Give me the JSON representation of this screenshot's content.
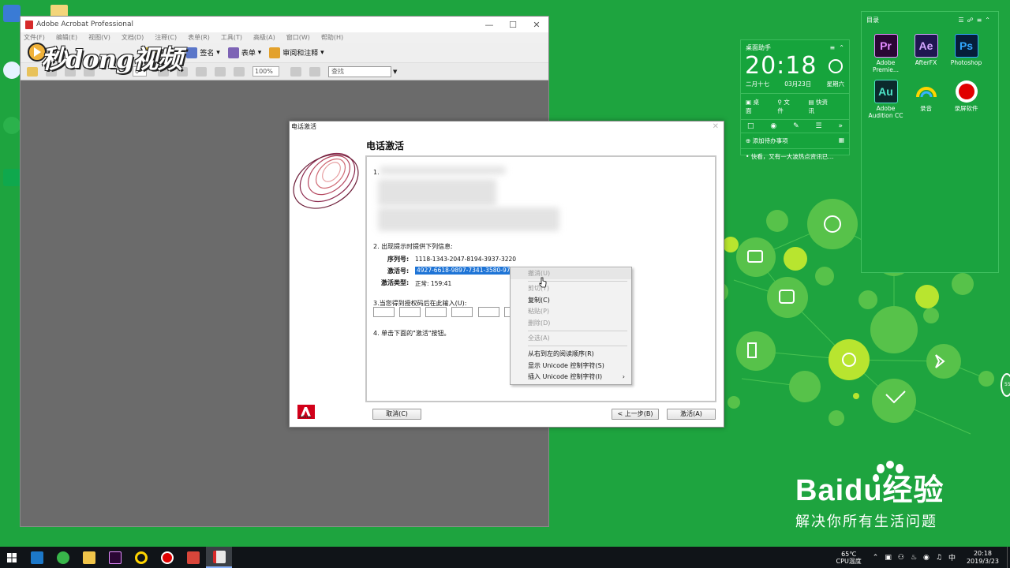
{
  "acrobat": {
    "title": "Adobe Acrobat Professional",
    "menu": [
      "文件(F)",
      "编辑(E)",
      "视图(V)",
      "文档(D)",
      "注释(C)",
      "表单(R)",
      "工具(T)",
      "高级(A)",
      "窗口(W)",
      "帮助(H)"
    ],
    "toolbar": {
      "security": "安全",
      "sign": "签名",
      "forms": "表单",
      "review": "审阅和注释"
    },
    "page_number": "0",
    "zoom": "100%",
    "find_placeholder": "查找",
    "watermark": "秒dong视频"
  },
  "dialog": {
    "title": "电话激活",
    "heading": "电话激活",
    "step1": "1.",
    "step2": "2. 出现提示时提供下列信息:",
    "serial_label": "序列号:",
    "serial_value": "1118-1343-2047-8194-3937-3220",
    "activation_label": "激活号:",
    "activation_value": "4927-6618-9897-7341-3580-9702-43",
    "type_label": "激活类型:",
    "type_value": "正常: 159:41",
    "step3": "3.当您得到授权码后在此输入(U):",
    "step4": "4. 单击下面的\"激活\"按钮。",
    "cancel_button": "取消(C)",
    "back_button": "< 上一步(B)",
    "activate_button": "激活(A)",
    "adobe_label": "Adobe"
  },
  "context_menu": {
    "items": [
      {
        "label": "撤消(U)",
        "enabled": false
      },
      {
        "label": "剪切(T)",
        "enabled": false
      },
      {
        "label": "复制(C)",
        "enabled": true
      },
      {
        "label": "粘贴(P)",
        "enabled": false
      },
      {
        "label": "删除(D)",
        "enabled": false
      },
      {
        "label": "全选(A)",
        "enabled": false
      },
      {
        "label": "从右到左的阅读顺序(R)",
        "enabled": true
      },
      {
        "label": "显示 Unicode 控制字符(S)",
        "enabled": true
      },
      {
        "label": "插入 Unicode 控制字符(I)",
        "enabled": true
      }
    ]
  },
  "helper": {
    "title": "桌面助手",
    "time": "20:18",
    "lunar": "二月十七",
    "date": "03月23日",
    "weekday": "星期六",
    "links": [
      "桌面",
      "文件",
      "快资讯"
    ],
    "todo": "添加待办事项",
    "news": "• 快看，又有一大波热点资讯已..."
  },
  "catalog": {
    "title": "目录",
    "apps": [
      {
        "icon": "Pr",
        "label": "Adobe Premie...",
        "color": "#2a0634",
        "fg": "#e48cff"
      },
      {
        "icon": "Ae",
        "label": "AfterFX",
        "color": "#1f1651",
        "fg": "#d3a6ff"
      },
      {
        "icon": "Ps",
        "label": "Photoshop",
        "color": "#061e3a",
        "fg": "#31a8ff"
      },
      {
        "icon": "Au",
        "label": "Adobe Audition CC",
        "color": "#0b2a2d",
        "fg": "#4ee6c9"
      },
      {
        "icon": "record-icon",
        "label": "录音",
        "color": "#1aa33f",
        "fg": "#ffd400"
      },
      {
        "icon": "screen-record-icon",
        "label": "录屏软件",
        "color": "#1aa33f",
        "fg": "#e00000"
      }
    ]
  },
  "baidu": {
    "brand": "Baidu经验",
    "slogan": "解决你所有生活问题"
  },
  "taskbar": {
    "temp": "65℃",
    "temp_label": "CPU温度",
    "ime": "中",
    "time": "20:18",
    "date": "2019/3/23"
  }
}
